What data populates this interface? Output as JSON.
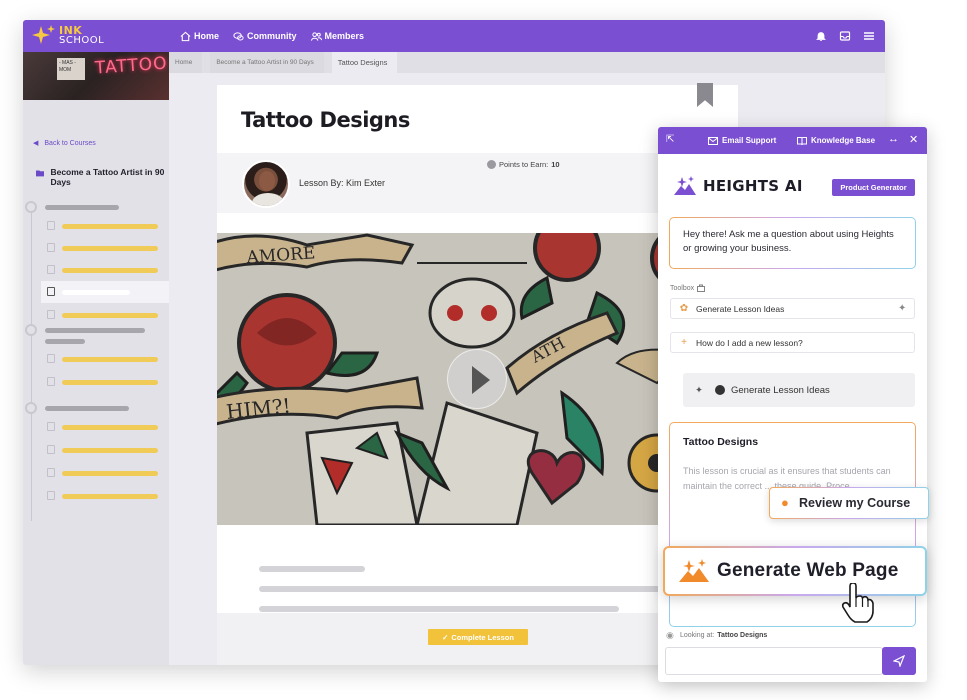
{
  "app": {
    "logo_line1": "INK",
    "logo_line2": "SCHOOL",
    "nav": [
      {
        "label": "Home",
        "icon": "home-icon"
      },
      {
        "label": "Community",
        "icon": "chat-icon"
      },
      {
        "label": "Members",
        "icon": "members-icon"
      }
    ],
    "top_icons": [
      "bell-icon",
      "inbox-icon",
      "menu-icon"
    ]
  },
  "sidebar": {
    "thumb_sign": "- MAS - MOM",
    "thumb_neon": "TATTOO",
    "back_label": "Back to Courses",
    "course_title": "Become a Tattoo Artist in 90 Days"
  },
  "breadcrumb": [
    "Home",
    "Become a Tattoo Artist in 90 Days",
    "Tattoo Designs"
  ],
  "lesson": {
    "title": "Tattoo Designs",
    "lesson_by": "Lesson By: Kim Exter",
    "points_label": "Points to Earn:",
    "points_value": "10",
    "complete_label": "Complete Lesson"
  },
  "ai_panel": {
    "email_support": "Email Support",
    "knowledge_base": "Knowledge Base",
    "brand": "HEIGHTS AI",
    "product_generator": "Product Generator",
    "greeting": "Hey there! Ask me a question about using Heights or growing your business.",
    "toolbox_label": "Toolbox",
    "tool_1": "Generate Lesson Ideas",
    "tool_2": "How do I add a new lesson?",
    "chip_label": "Generate Lesson Ideas",
    "result_title": "Tattoo Designs",
    "result_text": "This lesson is crucial as it ensures that students can maintain the correct ... these guide. Proce...",
    "looking_at_label": "Looking at:",
    "looking_at_value": "Tattoo Designs",
    "input_placeholder": ""
  },
  "callouts": {
    "review": "Review my Course",
    "generate_web": "Generate Web Page"
  },
  "colors": {
    "brand_purple": "#7b4fd1",
    "accent_yellow": "#f2c23b",
    "orange": "#f08a2b"
  }
}
